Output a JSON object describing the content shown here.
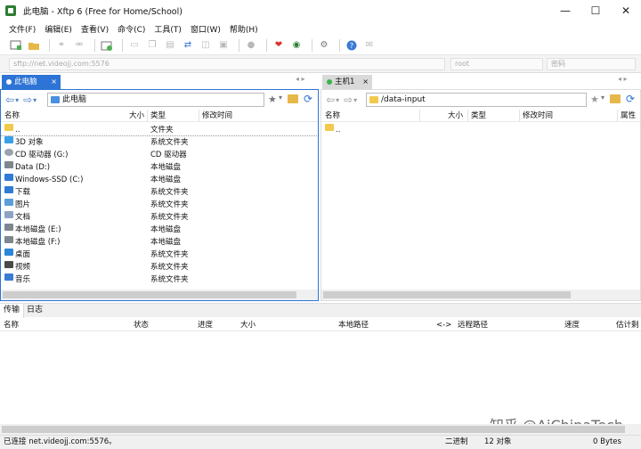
{
  "window": {
    "title": "此电脑 - Xftp 6 (Free for Home/School)",
    "controls": {
      "minimize": "—",
      "maximize": "☐",
      "close": "✕"
    }
  },
  "menu": [
    "文件(F)",
    "编辑(E)",
    "查看(V)",
    "命令(C)",
    "工具(T)",
    "窗口(W)",
    "帮助(H)"
  ],
  "address": {
    "host_placeholder": "sftp://net.videojj.com:5576",
    "user_placeholder": "root",
    "password_placeholder": "密码"
  },
  "left_pane": {
    "tab_label": "此电脑",
    "path": "此电脑",
    "columns": {
      "name": "名称",
      "size": "大小",
      "type": "类型",
      "modified": "修改时间"
    },
    "rows": [
      {
        "name": "..",
        "type": "文件夹",
        "icon": "folder-icon"
      },
      {
        "name": "3D 对象",
        "type": "系统文件夹",
        "icon": "cube-icon"
      },
      {
        "name": "CD 驱动器 (G:)",
        "type": "CD 驱动器",
        "icon": "cd-drive-icon"
      },
      {
        "name": "Data (D:)",
        "type": "本地磁盘",
        "icon": "disk-icon"
      },
      {
        "name": "Windows-SSD (C:)",
        "type": "本地磁盘",
        "icon": "windows-disk-icon"
      },
      {
        "name": "下载",
        "type": "系统文件夹",
        "icon": "download-icon"
      },
      {
        "name": "图片",
        "type": "系统文件夹",
        "icon": "pictures-icon"
      },
      {
        "name": "文档",
        "type": "系统文件夹",
        "icon": "document-icon"
      },
      {
        "name": "本地磁盘 (E:)",
        "type": "本地磁盘",
        "icon": "disk-icon"
      },
      {
        "name": "本地磁盘 (F:)",
        "type": "本地磁盘",
        "icon": "disk-icon"
      },
      {
        "name": "桌面",
        "type": "系统文件夹",
        "icon": "desktop-icon"
      },
      {
        "name": "视频",
        "type": "系统文件夹",
        "icon": "video-icon"
      },
      {
        "name": "音乐",
        "type": "系统文件夹",
        "icon": "music-icon"
      }
    ]
  },
  "right_pane": {
    "tab_label": "主机1",
    "path": "/data-input",
    "columns": {
      "name": "名称",
      "size": "大小",
      "type": "类型",
      "modified": "修改时间",
      "attributes": "属性"
    },
    "rows": [
      {
        "name": "..",
        "icon": "folder-icon"
      }
    ]
  },
  "lower": {
    "tabs": [
      "传输",
      "日志"
    ],
    "columns": [
      "名称",
      "状态",
      "进度",
      "大小",
      "本地路径",
      "<->",
      "远程路径",
      "速度",
      "估计剩"
    ]
  },
  "watermark": "知乎 @AiChinaTech",
  "status": {
    "connection": "已连接 net.videojj.com:5576。",
    "mode": "二进制",
    "objects": "12 对象",
    "bytes": "0 Bytes"
  },
  "colors": {
    "active_tab": "#2d74d6",
    "inactive_tab": "#d9d9d9",
    "folder": "#f2c94c",
    "connected_dot": "#3cb44b"
  }
}
